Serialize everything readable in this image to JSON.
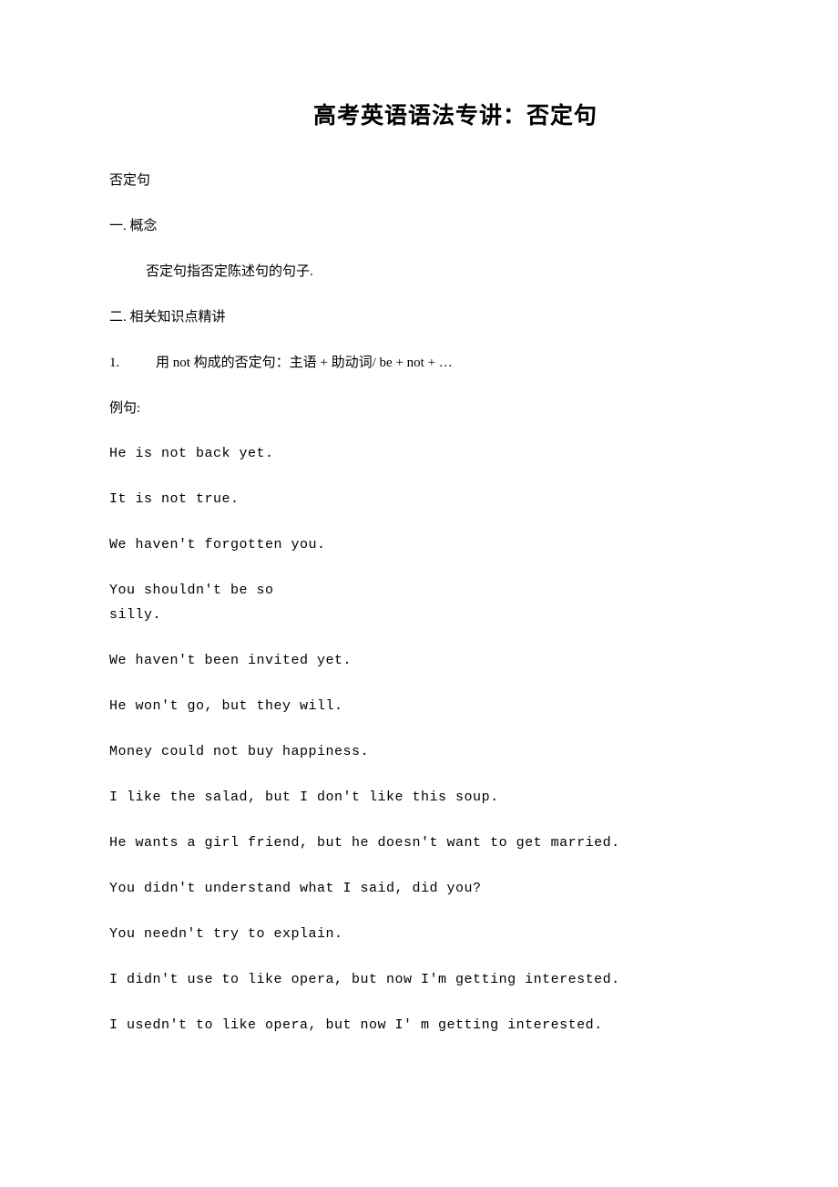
{
  "title": "高考英语语法专讲：否定句",
  "lines": {
    "l1": "否定句",
    "l2": "一. 概念",
    "l3": "否定句指否定陈述句的句子.",
    "l4": "二. 相关知识点精讲",
    "l5_num": "1.",
    "l5_text": "用 not 构成的否定句：主语 + 助动词/ be + not + …",
    "l6": "例句:",
    "e1": "He is not back yet.",
    "e2": "It is not true.",
    "e3": "We haven't forgotten you.",
    "e4a": "You shouldn't be so",
    "e4b": "silly.",
    "e5": "We haven't been invited yet.",
    "e6": "He won't go, but they will.",
    "e7": "Money could not buy happiness.",
    "e8": "I like the salad, but I don't like this soup.",
    "e9": "He wants a girl friend, but he doesn't want to get married.",
    "e10": "You didn't understand what I said, did you?",
    "e11": "You needn't try to explain.",
    "e12": "I didn't use to like opera, but now I'm getting interested.",
    "e13": "I usedn't to like opera, but now I' m getting interested."
  }
}
